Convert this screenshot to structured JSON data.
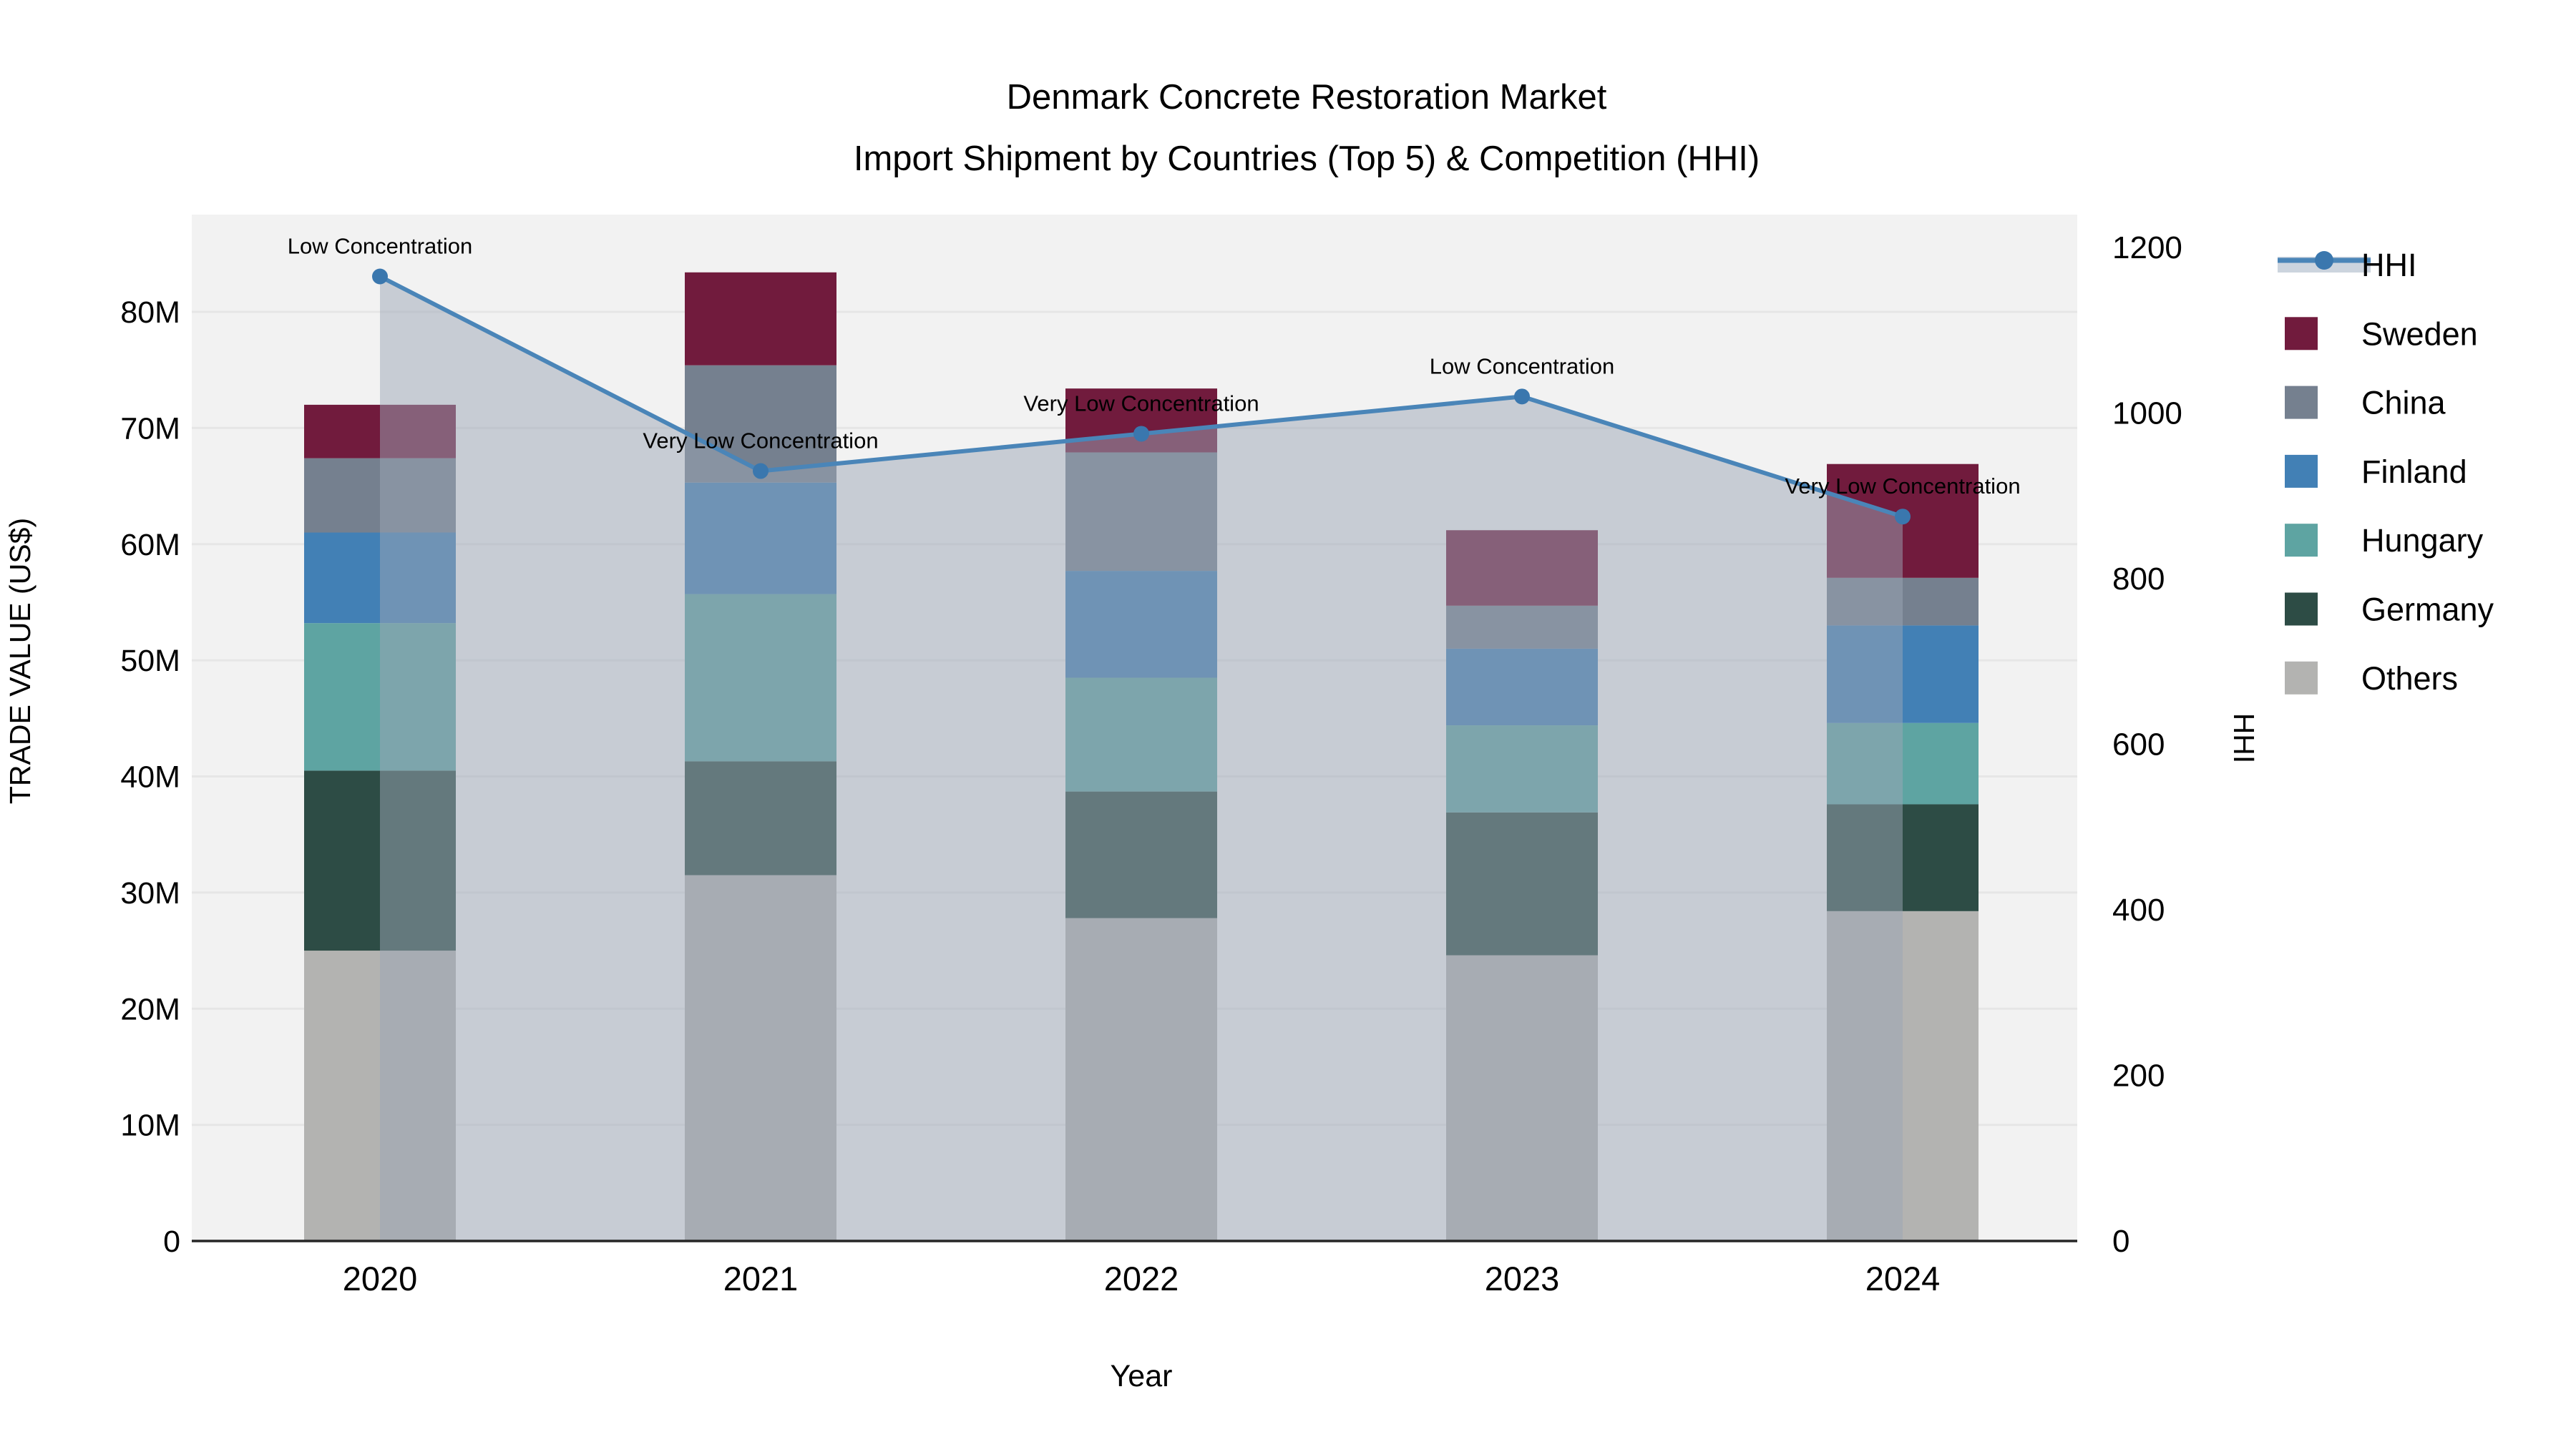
{
  "title": {
    "line1": "Denmark Concrete Restoration Market",
    "line2": "Import Shipment by Countries (Top 5) & Competition (HHI)"
  },
  "axes": {
    "x": {
      "label": "Year",
      "ticks": [
        "2020",
        "2021",
        "2022",
        "2023",
        "2024"
      ]
    },
    "y_left": {
      "label": "TRADE VALUE (US$)",
      "ticks": [
        "0",
        "10M",
        "20M",
        "30M",
        "40M",
        "50M",
        "60M",
        "70M",
        "80M"
      ]
    },
    "y_right": {
      "label": "HHI",
      "ticks": [
        "0",
        "200",
        "400",
        "600",
        "800",
        "1000",
        "1200"
      ]
    }
  },
  "legend": {
    "items": [
      "HHI",
      "Sweden",
      "China",
      "Finland",
      "Hungary",
      "Germany",
      "Others"
    ]
  },
  "colors": {
    "paper": "#ffffff",
    "plot_background": "#f2f2f2",
    "gridline": "#e6e6e6",
    "axis_line": "#262626",
    "hhi_line": "#4A85B8",
    "hhi_marker": "#3A77AE",
    "hhi_area_fill": "#9BA5B6",
    "hhi_legend_band": "#ccd4de"
  },
  "chart_data": {
    "type": "bar",
    "subtype": "stacked-bars-with-line-overlay",
    "x": [
      "2020",
      "2021",
      "2022",
      "2023",
      "2024"
    ],
    "bar_value_unit": "US$ millions",
    "stack_order_bottom_to_top": [
      "Others",
      "Germany",
      "Hungary",
      "Finland",
      "China",
      "Sweden"
    ],
    "series": [
      {
        "name": "Sweden",
        "color": "#711B3D",
        "values": [
          4.6,
          8.0,
          5.5,
          6.5,
          9.8
        ]
      },
      {
        "name": "China",
        "color": "#75808F",
        "values": [
          6.4,
          10.1,
          10.2,
          3.7,
          4.1
        ]
      },
      {
        "name": "Finland",
        "color": "#4280B5",
        "values": [
          7.8,
          9.6,
          9.2,
          6.6,
          8.4
        ]
      },
      {
        "name": "Hungary",
        "color": "#5EA4A2",
        "values": [
          12.7,
          14.4,
          9.8,
          7.5,
          7.0
        ]
      },
      {
        "name": "Germany",
        "color": "#2D4C45",
        "values": [
          15.5,
          9.8,
          10.9,
          12.3,
          9.2
        ]
      },
      {
        "name": "Others",
        "color": "#B3B3B1",
        "values": [
          25.0,
          31.5,
          27.8,
          24.6,
          28.4
        ]
      }
    ],
    "bar_totals": [
      72.0,
      83.4,
      73.4,
      61.2,
      66.9
    ],
    "line_series": {
      "name": "HHI",
      "values": [
        1165,
        930,
        975,
        1020,
        875
      ],
      "axis": "right"
    },
    "annotations": [
      {
        "x": "2020",
        "text": "Low Concentration"
      },
      {
        "x": "2021",
        "text": "Very Low Concentration"
      },
      {
        "x": "2022",
        "text": "Very Low Concentration"
      },
      {
        "x": "2023",
        "text": "Low Concentration"
      },
      {
        "x": "2024",
        "text": "Very Low Concentration"
      }
    ],
    "ylim_left_millions": [
      0,
      88.4
    ],
    "ylim_right": [
      0,
      1240
    ],
    "grid": "horizontal",
    "legend_position": "top-right"
  }
}
